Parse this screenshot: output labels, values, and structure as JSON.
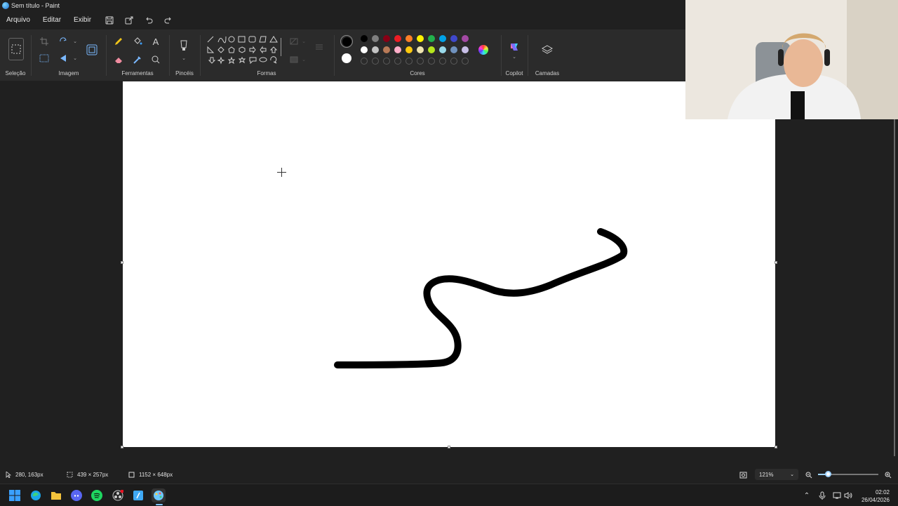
{
  "window": {
    "title": "Sem título - Paint"
  },
  "menu": {
    "file": "Arquivo",
    "edit": "Editar",
    "view": "Exibir"
  },
  "ribbon": {
    "selection_label": "Seleção",
    "image_label": "Imagem",
    "tools_label": "Ferramentas",
    "brushes_label": "Pincéis",
    "shapes_label": "Formas",
    "colors_label": "Cores",
    "copilot_label": "Copilot",
    "layers_label": "Camadas"
  },
  "colors": {
    "primary": "#000000",
    "secondary": "#ffffff",
    "row1": [
      "#000000",
      "#7f7f7f",
      "#880015",
      "#ed1c24",
      "#ff7f27",
      "#fff200",
      "#22b14c",
      "#00a2e8",
      "#3f48cc",
      "#a349a4"
    ],
    "row2": [
      "#ffffff",
      "#c3c3c3",
      "#b97a57",
      "#ffaec9",
      "#ffc90e",
      "#efe4b0",
      "#b5e61d",
      "#99d9ea",
      "#7092be",
      "#c8bfe7"
    ]
  },
  "status": {
    "cursor_pos": "280, 163px",
    "selection_size": "439 × 257px",
    "canvas_size": "1152 × 648px",
    "zoom": "121%"
  },
  "taskbar": {
    "time": "02:02",
    "date": "26/04/2026"
  }
}
